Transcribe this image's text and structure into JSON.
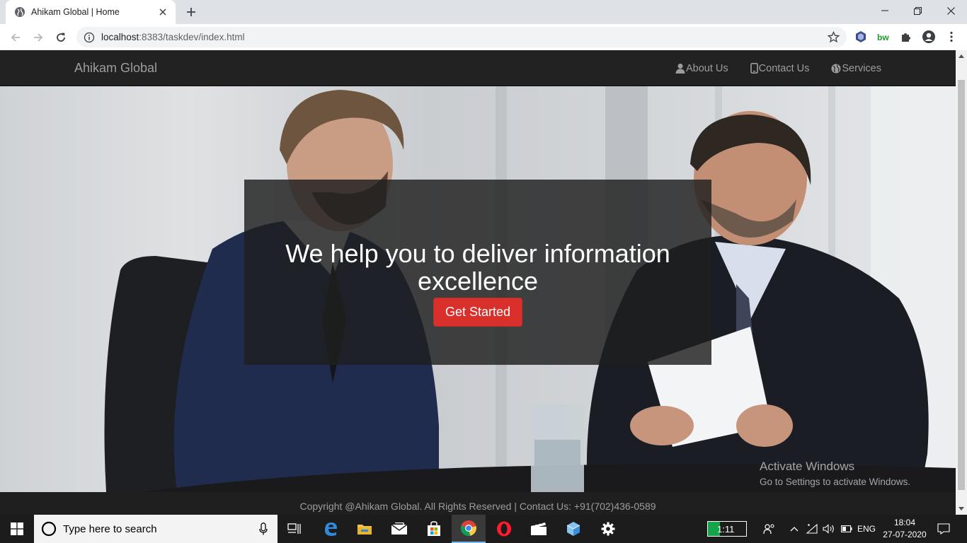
{
  "browser": {
    "tab_title": "Ahikam Global | Home",
    "url_host": "localhost",
    "url_rest": ":8383/taskdev/index.html"
  },
  "site": {
    "brand": "Ahikam Global",
    "nav": [
      {
        "label": "About Us",
        "icon": "user-icon"
      },
      {
        "label": "Contact Us",
        "icon": "mobile-phone-icon"
      },
      {
        "label": "Services",
        "icon": "globe-icon"
      }
    ],
    "hero": {
      "title": "We help you to deliver information excellence",
      "cta_label": "Get Started"
    },
    "footer_text": "Copyright @Ahikam Global. All Rights Reserved | Contact Us: +91(702)436-0589"
  },
  "watermark": {
    "line1": "Activate Windows",
    "line2": "Go to Settings to activate Windows."
  },
  "taskbar": {
    "search_placeholder": "Type here to search",
    "battery_label": "1:11",
    "language": "ENG",
    "time": "18:04",
    "date": "27-07-2020"
  },
  "colors": {
    "accent_button": "#d9302b",
    "navbar": "#222222",
    "taskbar": "#1c1c1c"
  }
}
